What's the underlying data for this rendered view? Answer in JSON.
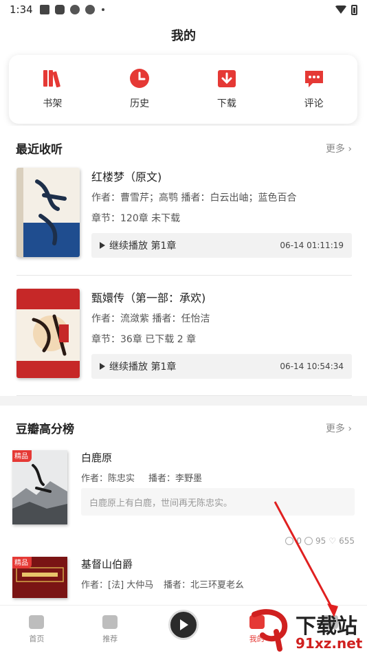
{
  "status_bar": {
    "time": "1:34"
  },
  "header": {
    "title": "我的"
  },
  "quick_actions": [
    {
      "label": "书架",
      "icon": "bookshelf-icon"
    },
    {
      "label": "历史",
      "icon": "history-clock-icon"
    },
    {
      "label": "下载",
      "icon": "download-icon"
    },
    {
      "label": "评论",
      "icon": "comment-icon"
    }
  ],
  "recent": {
    "title": "最近收听",
    "more": "更多",
    "items": [
      {
        "title": "红楼梦（原文)",
        "authors": "作者：曹雪芹；高鹗  播者：白云出岫；蓝色百合",
        "chapters": "章节：120章 未下载",
        "resume": "继续播放 第1章",
        "timestamp": "06-14 01:11:19"
      },
      {
        "title": "甄嬛传（第一部：承欢)",
        "authors": "作者：流潋紫  播者：任怡洁",
        "chapters": "章节：36章 已下载 2 章",
        "resume": "继续播放 第1章",
        "timestamp": "06-14 10:54:34"
      }
    ]
  },
  "ranking": {
    "title": "豆瓣高分榜",
    "more": "更多",
    "items": [
      {
        "tag": "精品",
        "title": "白鹿原",
        "author": "作者：陈忠实",
        "narrator": "播者：李野墨",
        "desc": "白鹿原上有白鹿，世间再无陈忠实。",
        "stat1": "0",
        "stat2": "95",
        "likes": "655"
      },
      {
        "tag": "精品",
        "title": "基督山伯爵",
        "author": "作者：[法] 大仲马",
        "narrator": "播者：北三环夏老幺"
      }
    ]
  },
  "tabbar": [
    {
      "label": "首页",
      "icon": "home-icon"
    },
    {
      "label": "推荐",
      "icon": "recommend-icon"
    },
    {
      "label": "",
      "icon": "play-icon"
    },
    {
      "label": "我的",
      "icon": "profile-icon"
    },
    {
      "label": "",
      "icon": "settings-icon"
    }
  ],
  "watermark": {
    "text": "下载站",
    "domain": "91xz.net"
  },
  "colors": {
    "accent": "#e53935",
    "background": "#f3f3f3",
    "card": "#ffffff"
  }
}
